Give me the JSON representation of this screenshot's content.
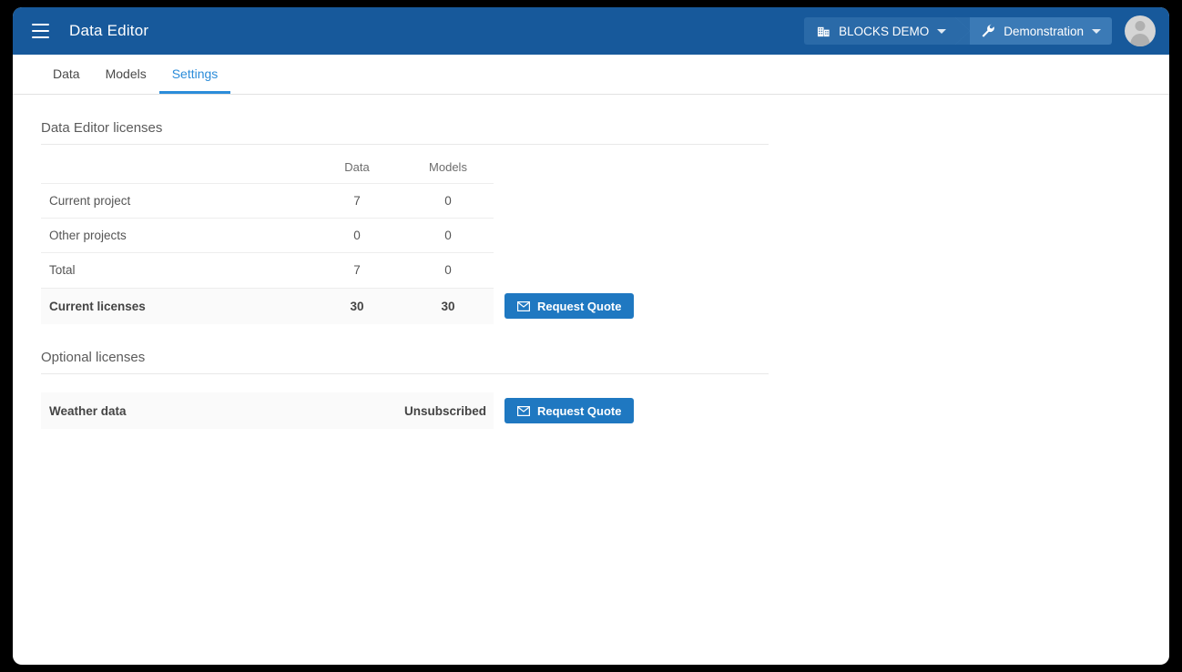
{
  "header": {
    "menu_icon": "hamburger-icon",
    "title": "Data Editor",
    "breadcrumbs": [
      {
        "icon": "building-icon",
        "label": "BLOCKS DEMO",
        "caret": "chevron-down-icon"
      },
      {
        "icon": "wrench-icon",
        "label": "Demonstration",
        "caret": "chevron-down-icon"
      }
    ],
    "avatar": "user-avatar-icon",
    "colors": {
      "bar": "#17599b",
      "crumb1": "#2a6aa8",
      "crumb2": "#3b7ab6"
    }
  },
  "tabs": [
    {
      "label": "Data",
      "active": false
    },
    {
      "label": "Models",
      "active": false
    },
    {
      "label": "Settings",
      "active": true
    }
  ],
  "sections": {
    "licenses": {
      "title": "Data Editor licenses",
      "columns": [
        "",
        "Data",
        "Models"
      ],
      "rows": [
        {
          "label": "Current project",
          "data": "7",
          "models": "0"
        },
        {
          "label": "Other projects",
          "data": "0",
          "models": "0"
        },
        {
          "label": "Total",
          "data": "7",
          "models": "0"
        }
      ],
      "total": {
        "label": "Current licenses",
        "data": "30",
        "models": "30",
        "action": {
          "icon": "envelope-icon",
          "label": "Request Quote"
        }
      }
    },
    "optional": {
      "title": "Optional licenses",
      "row": {
        "label": "Weather data",
        "status": "Unsubscribed",
        "action": {
          "icon": "envelope-icon",
          "label": "Request Quote"
        }
      }
    }
  },
  "colors": {
    "accent": "#2b8cd9",
    "button": "#1f78c1",
    "row_bg": "#fafafa"
  }
}
